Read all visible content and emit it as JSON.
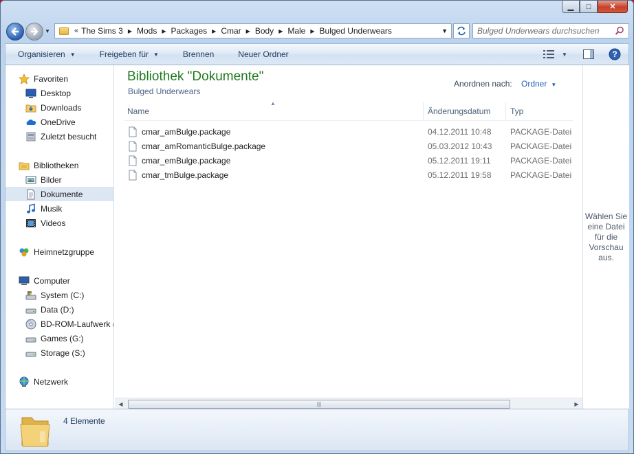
{
  "window": {
    "caption_buttons": {
      "minimize": "▁",
      "maximize": "□",
      "close": "✕"
    }
  },
  "address": {
    "overflow": "«",
    "crumbs": [
      "The Sims 3",
      "Mods",
      "Packages",
      "Cmar",
      "Body",
      "Male",
      "Bulged Underwears"
    ]
  },
  "search": {
    "placeholder": "Bulged Underwears durchsuchen"
  },
  "toolbar": {
    "organize": "Organisieren",
    "share": "Freigeben für",
    "burn": "Brennen",
    "new_folder": "Neuer Ordner"
  },
  "sidebar": {
    "favorites": {
      "label": "Favoriten",
      "items": [
        {
          "label": "Desktop",
          "icon": "desktop-icon"
        },
        {
          "label": "Downloads",
          "icon": "downloads-icon"
        },
        {
          "label": "OneDrive",
          "icon": "onedrive-icon"
        },
        {
          "label": "Zuletzt besucht",
          "icon": "recent-places-icon"
        }
      ]
    },
    "libraries": {
      "label": "Bibliotheken",
      "items": [
        {
          "label": "Bilder",
          "icon": "pictures-icon"
        },
        {
          "label": "Dokumente",
          "icon": "documents-icon",
          "selected": true
        },
        {
          "label": "Musik",
          "icon": "music-icon"
        },
        {
          "label": "Videos",
          "icon": "videos-icon"
        }
      ]
    },
    "homegroup": {
      "label": "Heimnetzgruppe"
    },
    "computer": {
      "label": "Computer",
      "items": [
        {
          "label": "System (C:)",
          "icon": "system-drive-icon"
        },
        {
          "label": "Data (D:)",
          "icon": "drive-icon"
        },
        {
          "label": "BD-ROM-Laufwerk (",
          "icon": "optical-drive-icon"
        },
        {
          "label": "Games (G:)",
          "icon": "drive-icon"
        },
        {
          "label": "Storage (S:)",
          "icon": "drive-icon"
        }
      ]
    },
    "network": {
      "label": "Netzwerk"
    }
  },
  "content": {
    "library_title": "Bibliothek \"Dokumente\"",
    "library_subtitle": "Bulged Underwears",
    "arrange_label": "Anordnen nach:",
    "arrange_value": "Ordner",
    "columns": {
      "name": "Name",
      "date": "Änderungsdatum",
      "type": "Typ"
    },
    "files": [
      {
        "name": "cmar_amBulge.package",
        "date": "04.12.2011 10:48",
        "type": "PACKAGE-Datei"
      },
      {
        "name": "cmar_amRomanticBulge.package",
        "date": "05.03.2012 10:43",
        "type": "PACKAGE-Datei"
      },
      {
        "name": "cmar_emBulge.package",
        "date": "05.12.2011 19:11",
        "type": "PACKAGE-Datei"
      },
      {
        "name": "cmar_tmBulge.package",
        "date": "05.12.2011 19:58",
        "type": "PACKAGE-Datei"
      }
    ]
  },
  "preview": {
    "text": "Wählen Sie eine Datei für die Vorschau aus."
  },
  "details": {
    "count": "4 Elemente"
  },
  "colors": {
    "title_green": "#1e7a1e",
    "link_blue": "#1e5fb4",
    "selection": "#dde7f3"
  }
}
